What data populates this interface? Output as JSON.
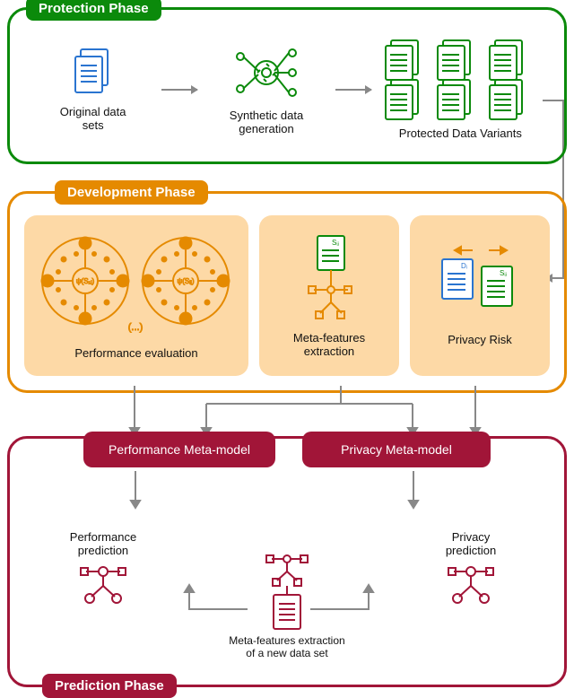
{
  "protection": {
    "title": "Protection Phase",
    "original_label": "Original data\nsets",
    "synth_label": "Synthetic data\ngeneration",
    "variants_label": "Protected Data Variants"
  },
  "development": {
    "title": "Development Phase",
    "perf_eval": "Performance evaluation",
    "perf_eval_formula_left": "ψ(S₁ᵢ)",
    "perf_eval_formula_right": "ψ(Sᵢⱼ)",
    "perf_eval_ellipsis": "(...)",
    "meta_feat": "Meta-features\nextraction",
    "meta_feat_doc_label": "Sᵢⱼ",
    "privacy_risk": "Privacy Risk",
    "privacy_doc_left": "Dᵢ",
    "privacy_doc_right": "Sᵢⱼ"
  },
  "prediction": {
    "title": "Prediction Phase",
    "perf_model": "Performance Meta-model",
    "priv_model": "Privacy Meta-model",
    "perf_pred": "Performance\nprediction",
    "priv_pred": "Privacy\nprediction",
    "center_label": "Meta-features extraction\nof a new data set"
  },
  "colors": {
    "green": "#0b8a0b",
    "blue": "#2a74d0",
    "orange": "#e58a00",
    "maroon": "#a11538"
  }
}
